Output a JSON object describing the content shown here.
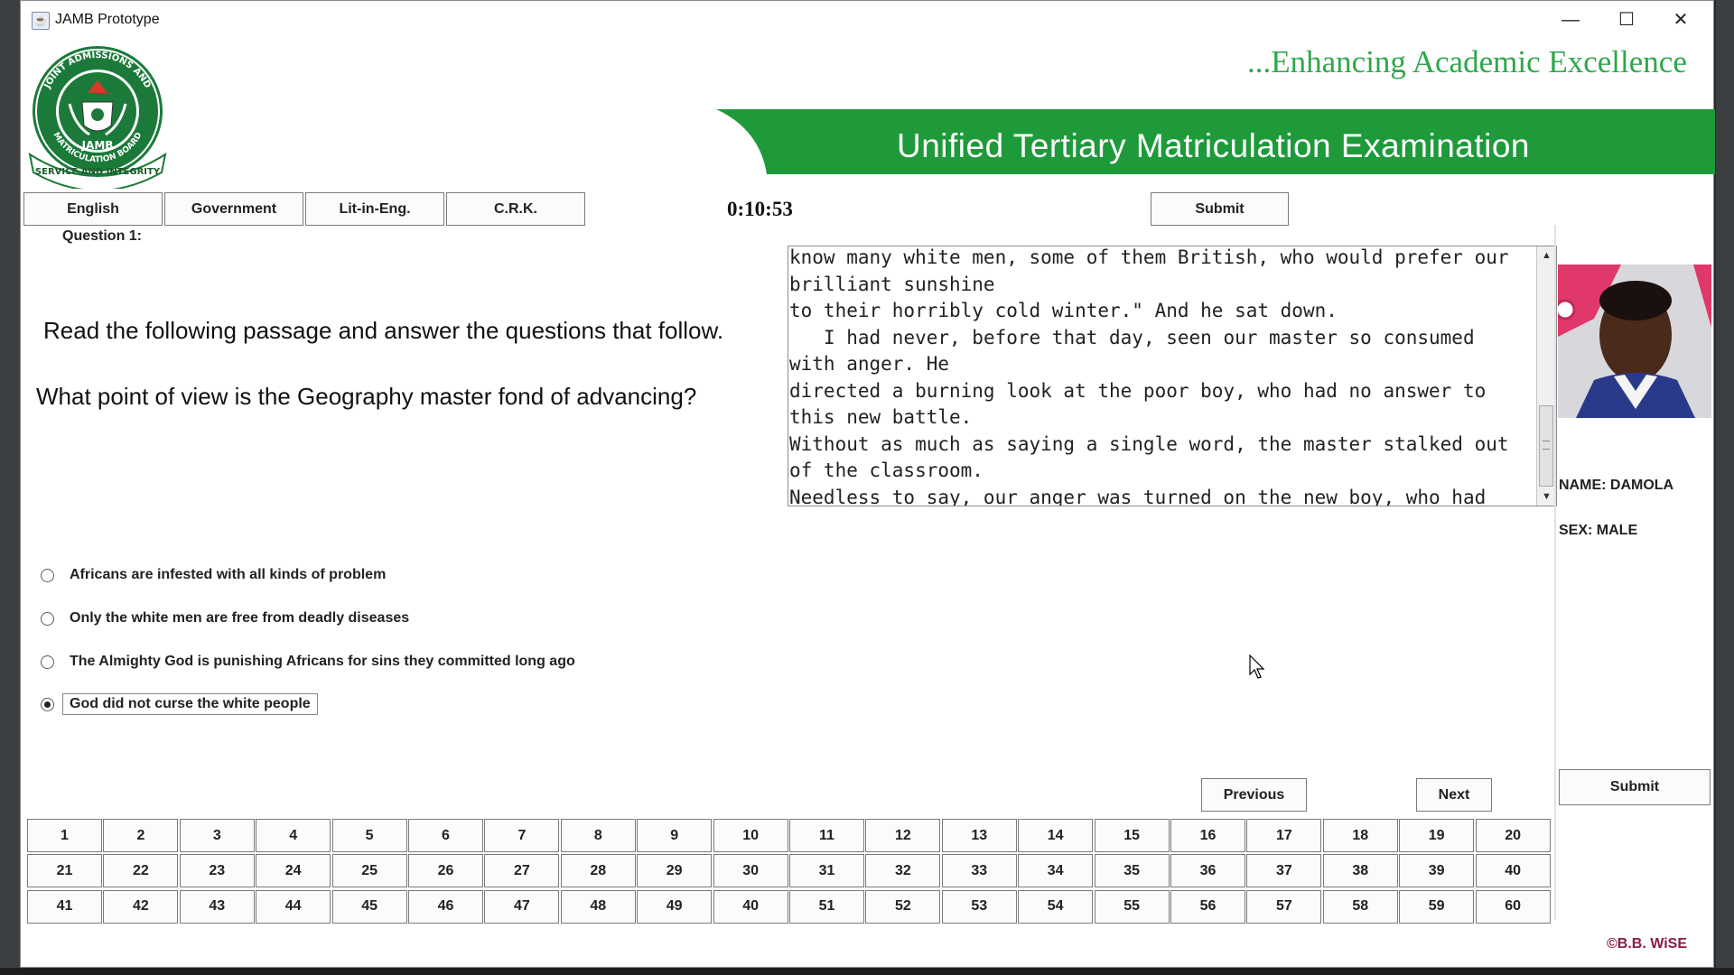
{
  "window": {
    "title": "JAMB Prototype",
    "minimize": "—",
    "maximize": "☐",
    "close": "✕"
  },
  "header": {
    "tagline": "...Enhancing Academic Excellence",
    "banner": "Unified Tertiary Matriculation Examination",
    "banner_color": "#1e9a3a",
    "tagline_color": "#2ea84a"
  },
  "subjects": [
    "English",
    "Government",
    "Lit-in-Eng.",
    "C.R.K."
  ],
  "timer": "0:10:53",
  "top_submit": "Submit",
  "question": {
    "number_label": "Question 1:",
    "instruction": "Read the following passage and answer the questions that follow.",
    "text": "What point of view is the Geography master fond of advancing?"
  },
  "passage": "know many white men, some of them British, who would prefer our brilliant sunshine\nto their horribly cold winter.\" And he sat down.\n   I had never, before that day, seen our master so consumed with anger. He\ndirected a burning look at the poor boy, who had no answer to this new battle.\nWithout as much as saying a single word, the master stalked out of the classroom.\nNeedless to say, our anger was turned on the new boy, who had decided to rock\nthe boat without taking the time to sound the water. A delegation was sent to the\nmaster to apologise to him. He was appeased. But we all noticed something rather\nunusual thereafter never again did he dwell on the issue of Africans being the\ncursed People.",
  "options": [
    {
      "label": "Africans are infested with all kinds of problem",
      "selected": false
    },
    {
      "label": "Only the white men are free from deadly diseases",
      "selected": false
    },
    {
      "label": "The Almighty God is punishing Africans for sins they committed long ago",
      "selected": false
    },
    {
      "label": "God did not curse the white people",
      "selected": true
    }
  ],
  "nav": {
    "previous": "Previous",
    "next": "Next"
  },
  "question_grid": [
    [
      "1",
      "2",
      "3",
      "4",
      "5",
      "6",
      "7",
      "8",
      "9",
      "10",
      "11",
      "12",
      "13",
      "14",
      "15",
      "16",
      "17",
      "18",
      "19",
      "20"
    ],
    [
      "21",
      "22",
      "23",
      "24",
      "25",
      "26",
      "27",
      "28",
      "29",
      "30",
      "31",
      "32",
      "33",
      "34",
      "35",
      "36",
      "37",
      "38",
      "39",
      "40"
    ],
    [
      "41",
      "42",
      "43",
      "44",
      "45",
      "46",
      "47",
      "48",
      "49",
      "40",
      "51",
      "52",
      "53",
      "54",
      "55",
      "56",
      "57",
      "58",
      "59",
      "60"
    ]
  ],
  "candidate": {
    "name": "NAME: DAMOLA",
    "sex": "SEX: MALE"
  },
  "side_submit": "Submit",
  "copyright": "©B.B. WiSE",
  "logo": {
    "ring_text_top": "JOINT ADMISSIONS AND",
    "ring_text_bottom": "MATRICULATION BOARD",
    "center": "JAMB",
    "ribbon": "SERVICE AND INTEGRITY"
  }
}
